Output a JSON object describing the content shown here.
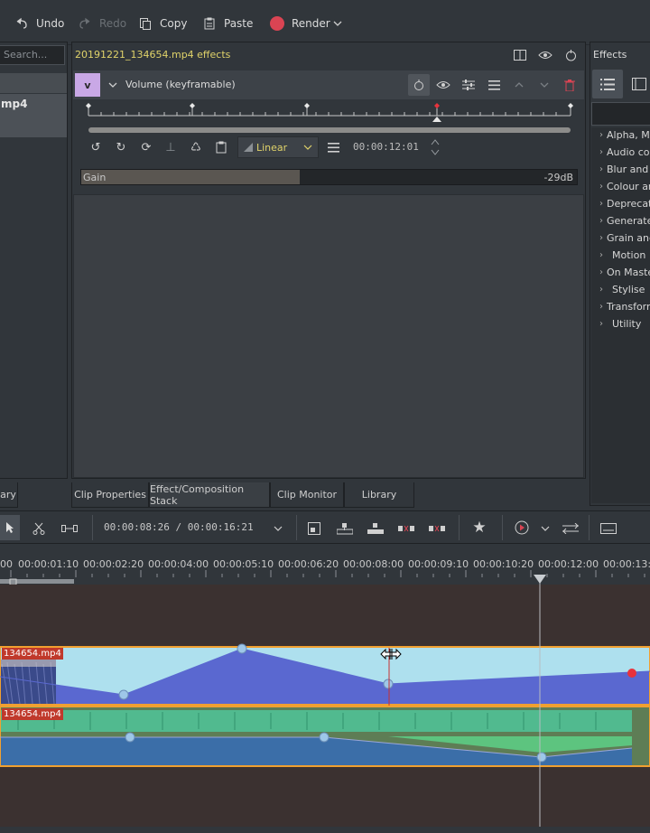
{
  "toolbar": {
    "undo": "Undo",
    "redo": "Redo",
    "copy": "Copy",
    "paste": "Paste",
    "render": "Render"
  },
  "project_bin": {
    "search_placeholder": "Search...",
    "clip_name_fragment": "mp4"
  },
  "effect_stack": {
    "title": "20191221_134654.mp4 effects",
    "effect_badge": "v",
    "effect_name": "Volume (keyframable)",
    "interpolation": "Linear",
    "keyframe_time": "00:00:12:01",
    "param_name": "Gain",
    "param_value": "-29dB",
    "param_fill": 0.44
  },
  "effects_panel": {
    "title": "Effects",
    "categories": [
      "Alpha, Mask and Keying",
      "Audio correction",
      "Blur and Sharpen",
      "Colour and Image correction",
      "Deprecated",
      "Generate",
      "Grain and Noise",
      "Motion",
      "On Master",
      "Stylise",
      "Transform, Distort and Perspective",
      "Utility"
    ],
    "categories_visible": [
      "Alpha, Ma",
      "Audio cor",
      "Blur and S",
      "Colour an",
      "Deprecat",
      "Generate",
      "Grain and",
      "Motion",
      "On Master",
      "Stylise",
      "Transform",
      "Utility"
    ]
  },
  "tabs": {
    "left_partial": "ary",
    "clip_properties": "Clip Properties",
    "effect_stack": "Effect/Composition Stack",
    "clip_monitor": "Clip Monitor",
    "library": "Library"
  },
  "timeline": {
    "position": "00:00:08:26 / 00:00:16:21",
    "ruler": [
      "00",
      "00:00:01:10",
      "00:00:02:20",
      "00:00:04:00",
      "00:00:05:10",
      "00:00:06:20",
      "00:00:08:00",
      "00:00:09:10",
      "00:00:10:20",
      "00:00:12:00",
      "00:00:13:1"
    ],
    "video_clip": "134654.mp4",
    "audio_clip": "134654.mp4"
  },
  "colors": {
    "accent_yellow": "#e0d36a",
    "render_red": "#da4453",
    "clip_border": "#f0a030",
    "video_clip_bg": "#aee0ee",
    "keyframe_fill": "#5a68d0",
    "audio_green": "#4fc49a",
    "audio_blue": "#3b6ea8",
    "track_bg": "#3b3130"
  }
}
